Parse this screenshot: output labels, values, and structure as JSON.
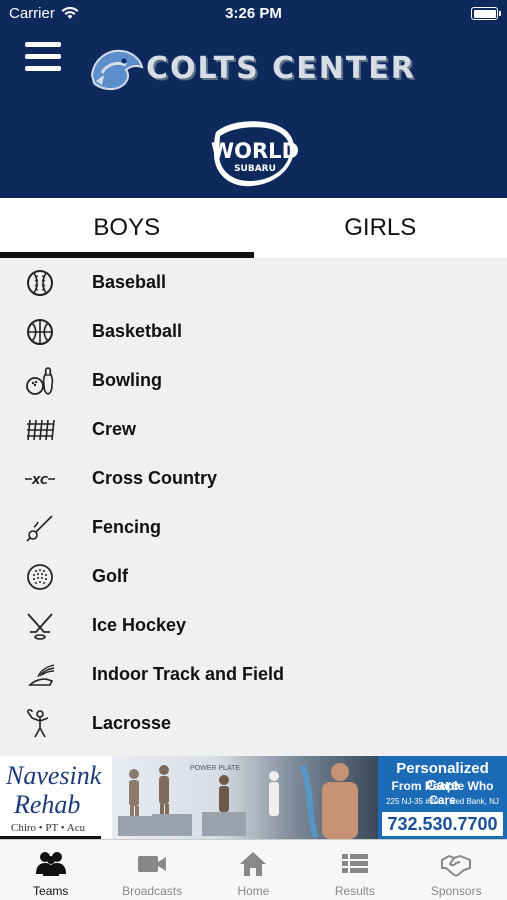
{
  "status_bar": {
    "carrier": "Carrier",
    "time": "3:26 PM"
  },
  "header": {
    "title": "COLTS CENTER",
    "sponsor_line1": "WORLD",
    "sponsor_line2": "SUBARU"
  },
  "tabs": [
    {
      "label": "BOYS",
      "active": true
    },
    {
      "label": "GIRLS",
      "active": false
    }
  ],
  "sports": [
    {
      "label": "Baseball",
      "icon": "baseball-icon"
    },
    {
      "label": "Basketball",
      "icon": "basketball-icon"
    },
    {
      "label": "Bowling",
      "icon": "bowling-icon"
    },
    {
      "label": "Crew",
      "icon": "crew-icon"
    },
    {
      "label": "Cross Country",
      "icon": "cross-country-icon"
    },
    {
      "label": "Fencing",
      "icon": "fencing-icon"
    },
    {
      "label": "Golf",
      "icon": "golf-icon"
    },
    {
      "label": "Ice Hockey",
      "icon": "ice-hockey-icon"
    },
    {
      "label": "Indoor Track and Field",
      "icon": "winged-shoe-icon"
    },
    {
      "label": "Lacrosse",
      "icon": "lacrosse-icon"
    }
  ],
  "ad": {
    "left_line1": "Navesink",
    "left_line2": "Rehab",
    "left_line3": "Chiro • PT • Acu",
    "right_line1": "Personalized Care",
    "right_line2": "From People Who Care",
    "right_line3": "225 NJ-35 #205 | Red Bank, NJ",
    "phone": "732.530.7700",
    "photo_text": "POWER PLATE"
  },
  "tabbar": [
    {
      "label": "Teams",
      "icon": "people-icon",
      "active": true
    },
    {
      "label": "Broadcasts",
      "icon": "video-camera-icon",
      "active": false
    },
    {
      "label": "Home",
      "icon": "home-icon",
      "active": false
    },
    {
      "label": "Results",
      "icon": "list-icon",
      "active": false
    },
    {
      "label": "Sponsors",
      "icon": "handshake-icon",
      "active": false
    }
  ],
  "colors": {
    "header": "#0e2a5c",
    "active_tab_underline": "#111111",
    "ad_blue": "#1b6bb6"
  }
}
